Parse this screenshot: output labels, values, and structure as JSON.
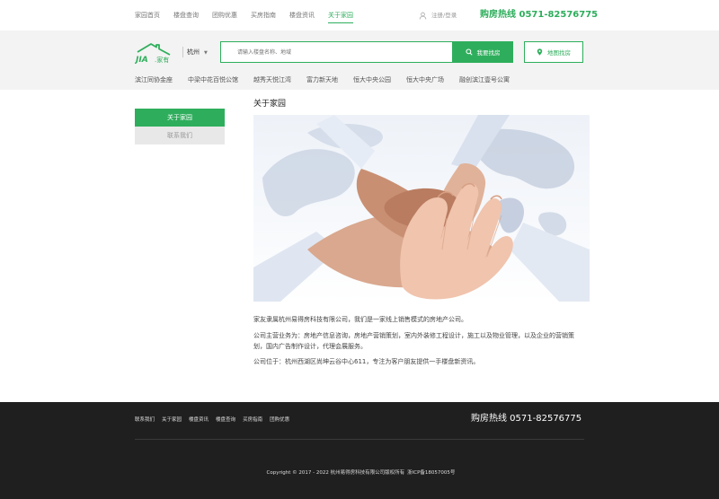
{
  "topnav": {
    "items": [
      "家园首页",
      "楼盘查询",
      "团购优惠",
      "买房指南",
      "楼盘资讯",
      "关于家园"
    ],
    "active_index": 5,
    "login_label": "注册/登录",
    "hotline": "购房热线  0571-82576775"
  },
  "logo": {
    "mark": "JIA",
    "text": "家有"
  },
  "search": {
    "city": "杭州",
    "placeholder": "请输入楼盘名称、地域",
    "button_label": "我要找房",
    "map_label": "地图找房"
  },
  "hot_projects": [
    "滨江同协金座",
    "中梁中花百悦公馆",
    "越秀天悦江湾",
    "富力新天地",
    "恒大中央公园",
    "恒大中央广场",
    "融创滨江壹号公寓"
  ],
  "sidebar": {
    "active_label": "关于家园",
    "item_label": "联系我们"
  },
  "main": {
    "title": "关于家园",
    "paragraph_1": "家友隶属杭州易得房科技有限公司，我们是一家线上销售模式的房地产公司。",
    "paragraph_2": "公司主营业务为：房地产信息咨询，房地产营销策划，室内外装修工程设计，施工以及物业管理，以及企业的营销策划，国内广告制作设计，代理会展服务。",
    "paragraph_3": "公司位于：杭州西湖区尚坤云谷中心611，专注为客户朋友提供一手楼盘新资讯。"
  },
  "footer": {
    "links": [
      "联系我们",
      "关于家园",
      "楼盘资讯",
      "楼盘查询",
      "买房指南",
      "团购优惠"
    ],
    "hotline": "购房热线  0571-82576775",
    "copyright": "Copyright © 2017 - 2022 杭州易得房科技有限公司版权所有",
    "icp": "浙ICP备18057005号"
  },
  "colors": {
    "brand": "#2eae5c",
    "footer_bg": "#1f1f1f",
    "band_bg": "#f2f3f2"
  }
}
